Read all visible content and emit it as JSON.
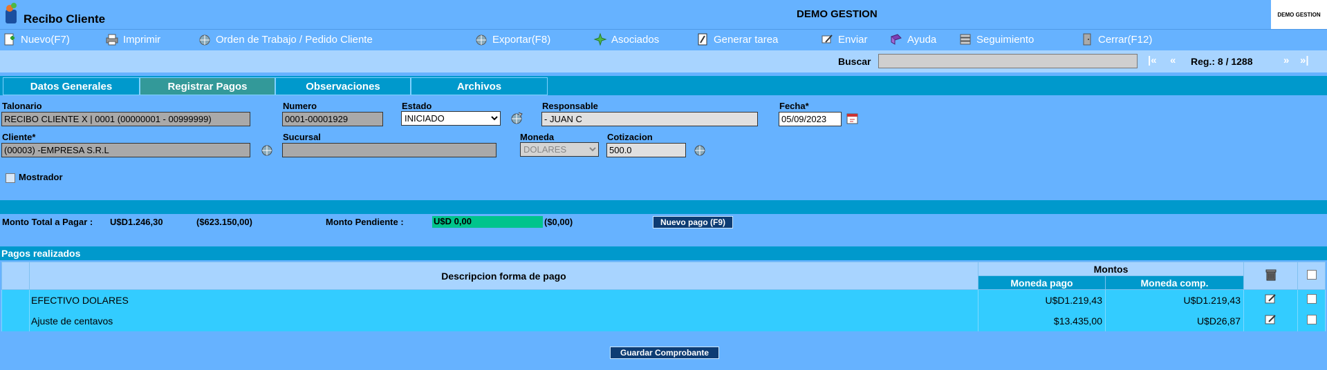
{
  "window": {
    "title": "Recibo Cliente",
    "company": "DEMO GESTION",
    "company_badge": "DEMO GESTION"
  },
  "toolbar": {
    "items": [
      {
        "label": "Nuevo(F7)",
        "icon": "new-doc-icon"
      },
      {
        "label": "Imprimir",
        "icon": "printer-icon"
      },
      {
        "label": "Orden de Trabajo / Pedido Cliente",
        "icon": "globe-icon"
      },
      {
        "label": "Exportar(F8)",
        "icon": "export-icon"
      },
      {
        "label": "Asociados",
        "icon": "associates-icon"
      },
      {
        "label": "Generar tarea",
        "icon": "task-icon"
      },
      {
        "label": "Enviar",
        "icon": "send-icon"
      },
      {
        "label": "Ayuda",
        "icon": "help-book-icon"
      },
      {
        "label": "Seguimiento",
        "icon": "tracking-icon"
      },
      {
        "label": "Cerrar(F12)",
        "icon": "close-door-icon"
      }
    ]
  },
  "search": {
    "label": "Buscar",
    "value": "",
    "nav_first": "|«",
    "nav_prev": "«",
    "nav_next": "»",
    "nav_last": "»|",
    "record": "Reg.: 8 / 1288"
  },
  "tabs": [
    {
      "label": "Datos Generales",
      "active": false
    },
    {
      "label": "Registrar Pagos",
      "active": true
    },
    {
      "label": "Observaciones",
      "active": false
    },
    {
      "label": "Archivos",
      "active": false
    }
  ],
  "form": {
    "talonario_label": "Talonario",
    "talonario_value": "RECIBO CLIENTE X | 0001 (00000001 - 00999999)",
    "numero_label": "Numero",
    "numero_value": "0001-00001929",
    "estado_label": "Estado",
    "estado_value": "INICIADO",
    "responsable_label": "Responsable",
    "responsable_value": "- JUAN C",
    "fecha_label": "Fecha*",
    "fecha_value": "05/09/2023",
    "cliente_label": "Cliente*",
    "cliente_value": "(00003) -EMPRESA S.R.L",
    "sucursal_label": "Sucursal",
    "sucursal_value": "",
    "moneda_label": "Moneda",
    "moneda_value": "DOLARES",
    "cotizacion_label": "Cotizacion",
    "cotizacion_value": "500.0",
    "mostrador_label": "Mostrador"
  },
  "summary": {
    "total_label": "Monto Total a Pagar :",
    "total_usd": "U$D1.246,30",
    "total_ars": "($623.150,00)",
    "pending_label": "Monto Pendiente :",
    "pending_usd": "U$D 0,00",
    "pending_ars": "($0,00)",
    "new_payment_button": "Nuevo pago (F9)"
  },
  "payments": {
    "title": "Pagos realizados",
    "header_desc": "Descripcion forma de pago",
    "header_montos": "Montos",
    "header_moneda_pago": "Moneda pago",
    "header_moneda_comp": "Moneda comp.",
    "rows": [
      {
        "desc": "EFECTIVO DOLARES",
        "moneda_pago": "U$D1.219,43",
        "moneda_comp": "U$D1.219,43"
      },
      {
        "desc": "Ajuste de centavos",
        "moneda_pago": "$13.435,00",
        "moneda_comp": "U$D26,87"
      }
    ]
  },
  "save_button": "Guardar Comprobante",
  "colors": {
    "background": "#66b2ff",
    "bar": "#0099cc",
    "row": "#33ccff",
    "pending": "#00c48c",
    "button": "#0d3c73"
  }
}
